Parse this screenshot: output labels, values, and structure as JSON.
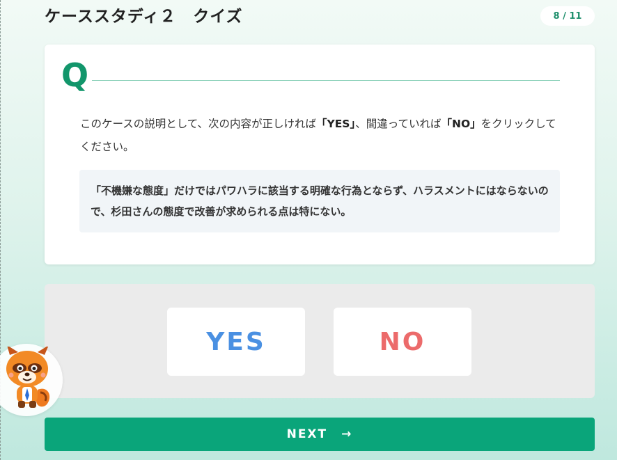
{
  "header": {
    "title": "ケーススタディ２　クイズ",
    "progress": "8 / 11"
  },
  "question": {
    "marker": "Q",
    "text_before_yes": "このケースの説明として、次の内容が正しければ",
    "yes_term": "「YES」",
    "text_middle": "、間違っていれば",
    "no_term": "「NO」",
    "text_after": "をクリックしてください。",
    "statement": "「不機嫌な態度」だけではパワハラに該当する明確な行為とならず、ハラスメントにはならないので、杉田さんの態度で改善が求められる点は特にない。"
  },
  "answers": {
    "yes_label": "YES",
    "no_label": "NO"
  },
  "footer": {
    "next_label": "NEXT",
    "next_icon": "→"
  },
  "colors": {
    "accent": "#0aa57a",
    "yes": "#4a90e2",
    "no": "#ec6b6b"
  },
  "mascot": {
    "icon": "raccoon-mascot-icon"
  }
}
